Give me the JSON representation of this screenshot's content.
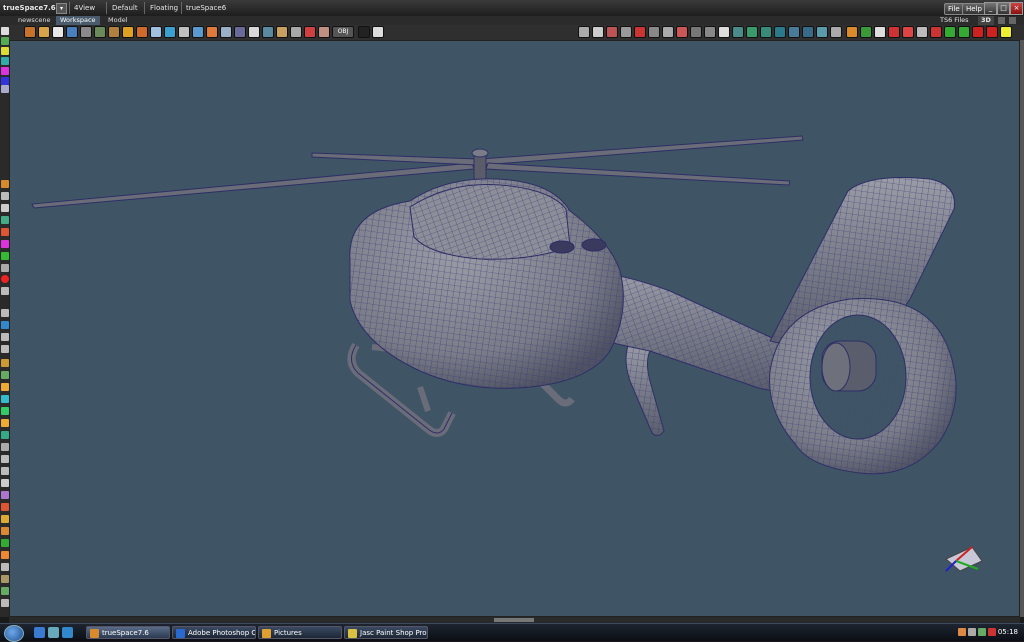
{
  "titlebar": {
    "app_title": "trueSpace7.6",
    "layouts": [
      "4View",
      "Default",
      "Floating",
      "trueSpace6"
    ],
    "file_label": "File",
    "help_label": "Help",
    "ts6_files_label": "TS6 Files",
    "mode_3d_label": "3D"
  },
  "tabs": {
    "scene": "newscene",
    "workspace": "Workspace",
    "model": "Model"
  },
  "toolbar": {
    "obj_label": "OBJ"
  },
  "taskbar": {
    "tasks": [
      {
        "label": "trueSpace7.6"
      },
      {
        "label": "Adobe Photoshop C..."
      },
      {
        "label": "Pictures"
      },
      {
        "label": "Jasc Paint Shop Pro ..."
      }
    ],
    "clock": "05:18"
  },
  "colors": {
    "viewport_bg": "#3f5566",
    "mesh_fill": "#7d7f8c",
    "wire": "#3a3a7a"
  }
}
